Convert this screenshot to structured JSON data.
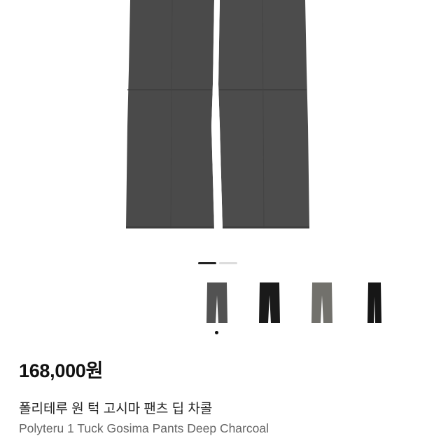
{
  "product": {
    "price": "168,000원",
    "name_ko": "폴리테루 원 턱 고시마 팬츠 딥 차콜",
    "name_en": "Polyteru 1 Tuck Gosima Pants Deep Charcoal"
  },
  "gallery": {
    "page_count": 2,
    "active_page": 1
  },
  "colors": {
    "deep_charcoal": "#4a4a4a",
    "black": "#1b1b1b",
    "gray": "#6b6b66",
    "black_slim": "#141414",
    "background": "#ffffff"
  },
  "swatches": [
    {
      "name": "deep-charcoal",
      "color": "#4d4d4d",
      "selected": true
    },
    {
      "name": "black",
      "color": "#1a1a1a",
      "selected": false
    },
    {
      "name": "gray",
      "color": "#72716c",
      "selected": false
    },
    {
      "name": "black-slim",
      "color": "#161616",
      "selected": false
    }
  ]
}
